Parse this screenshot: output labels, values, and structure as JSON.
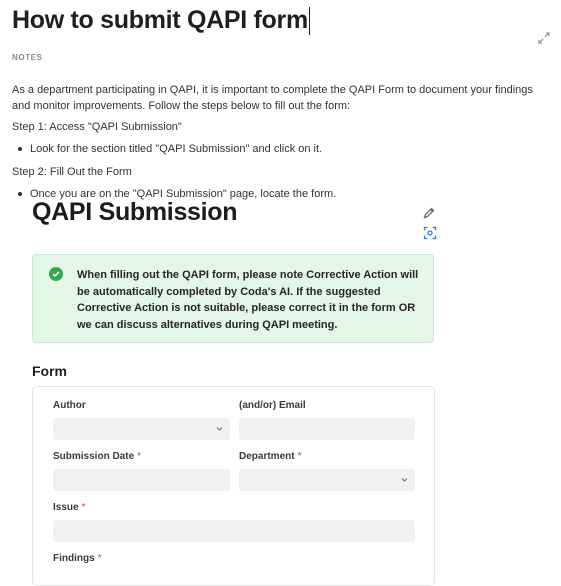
{
  "page": {
    "title": "How to submit QAPI form",
    "notes_label": "NOTES",
    "intro": "As a department participating in QAPI, it is important to complete the QAPI Form to document your findings and monitor improvements. Follow the steps below to fill out the form:",
    "step1": "Step 1: Access \"QAPI Submission\"",
    "step1_bullet": "Look for the section titled \"QAPI Submission\" and click on it.",
    "step2": "Step 2: Fill Out the Form",
    "step2_bullet": "Once you are on the \"QAPI Submission\" page, locate the form."
  },
  "embed": {
    "title": "QAPI Submission",
    "callout": "When filling out the QAPI form, please note Corrective Action will be automatically completed by Coda's AI. If the suggested Corrective Action is not suitable, please correct it in the form OR we can discuss alternatives during QAPI meeting."
  },
  "form": {
    "heading": "Form",
    "required_marker": "*",
    "fields": {
      "author": "Author",
      "email": "(and/or) Email",
      "submission_date": "Submission Date",
      "department": "Department",
      "issue": "Issue",
      "findings": "Findings"
    }
  },
  "colors": {
    "callout_bg": "#e3f6e7",
    "check_green": "#2dad4e",
    "required_red": "#d6453b"
  },
  "icons": [
    "expand-icon",
    "pencil-icon",
    "screen-capture-icon",
    "check-circle-icon",
    "chevron-down-icon"
  ]
}
